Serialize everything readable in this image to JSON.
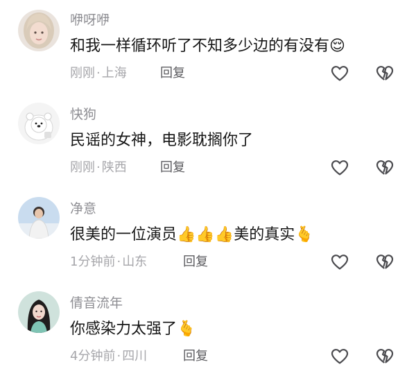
{
  "comments": [
    {
      "username": "咿呀咿",
      "text": "和我一样循环听了不知多少边的有没有",
      "emojis": "😌",
      "time": "刚刚",
      "location": "上海",
      "reply_label": "回复",
      "avatar": "avatar-girl-light-hair"
    },
    {
      "username": "快狗",
      "text": "民谣的女神，电影耽搁你了",
      "emojis": "",
      "time": "刚刚",
      "location": "陕西",
      "reply_label": "回复",
      "avatar": "avatar-white-bear"
    },
    {
      "username": "净意",
      "text": "很美的一位演员",
      "emojis": "👍👍👍",
      "text2": "美的真实",
      "emojis2": "🫰",
      "time": "1分钟前",
      "location": "山东",
      "reply_label": "回复",
      "avatar": "avatar-man-sky"
    },
    {
      "username": "倩音流年",
      "text": "你感染力太强了",
      "emojis": "🫰",
      "time": "4分钟前",
      "location": "四川",
      "reply_label": "回复",
      "avatar": "avatar-woman-teal"
    }
  ],
  "meta_separator": "·",
  "icons": {
    "like": "heart-outline-icon",
    "dislike": "broken-heart-icon"
  },
  "colors": {
    "username": "#8e8e93",
    "text": "#161616",
    "meta": "#a6a6aa",
    "reply": "#5a5a5e",
    "icon": "#4a4a4e"
  }
}
